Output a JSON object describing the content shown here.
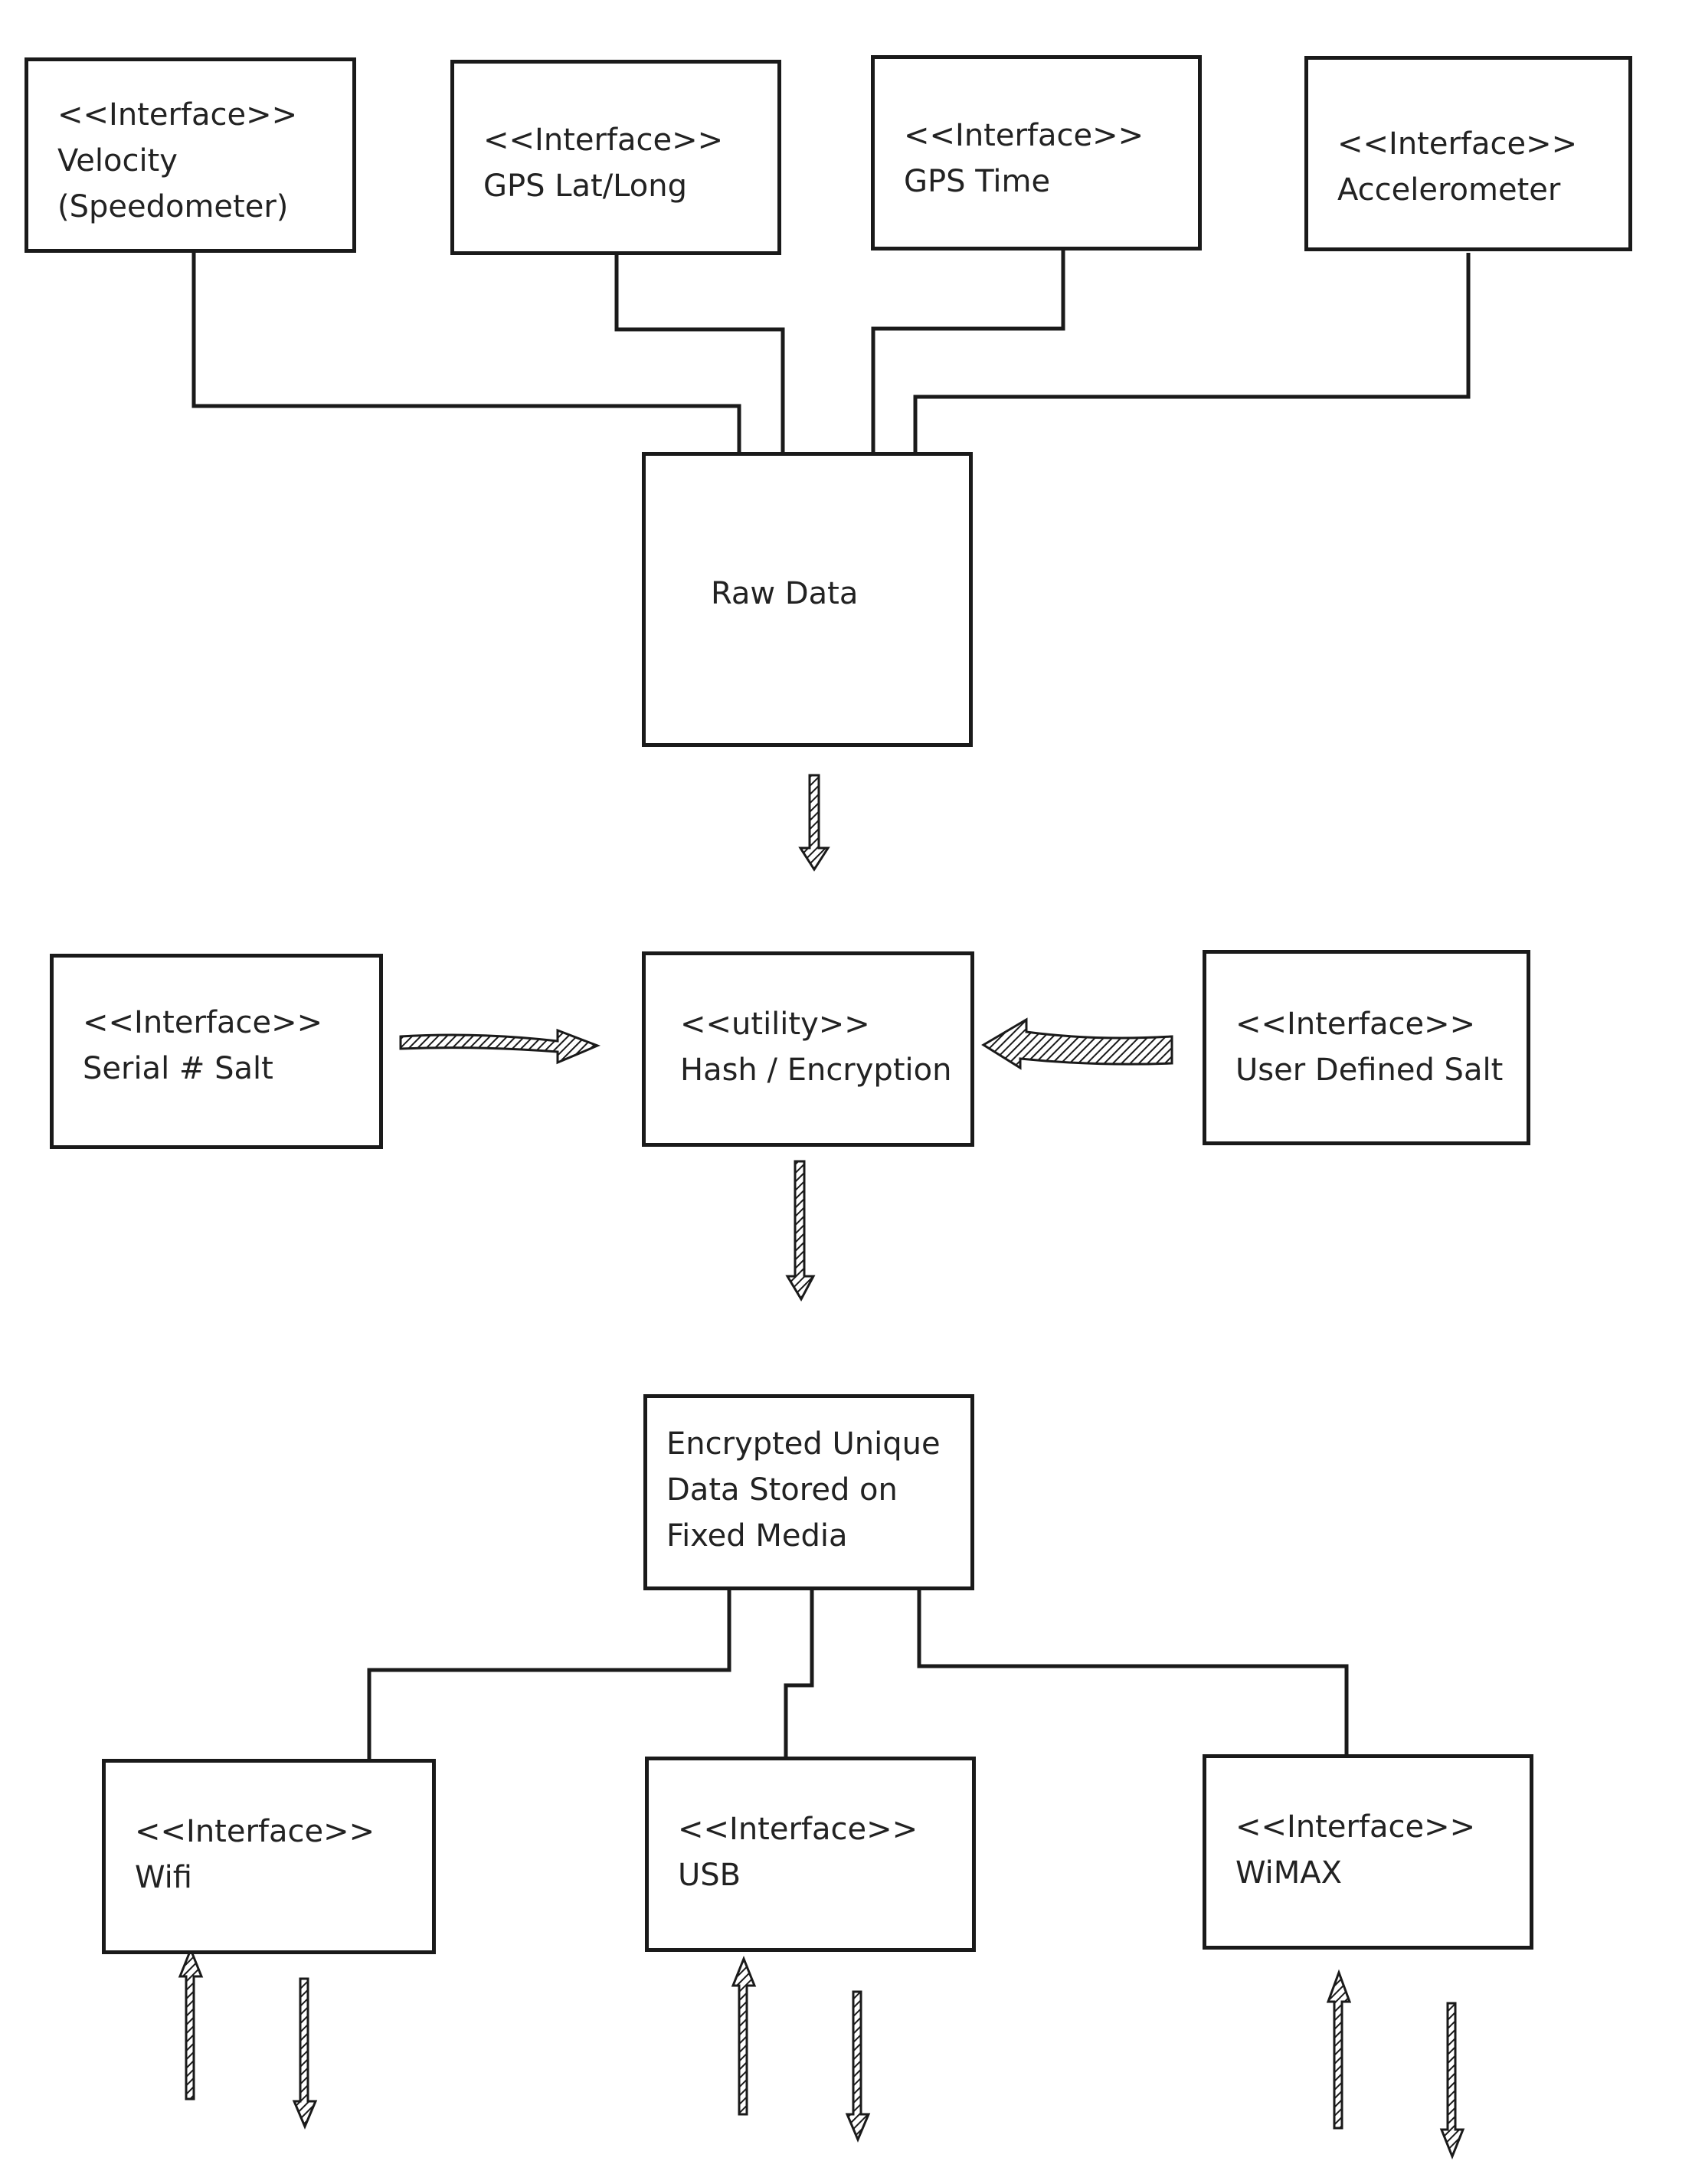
{
  "diagram": {
    "type": "block-diagram",
    "style": {
      "stroke_color": "#1a1a1a",
      "text_color": "#222222",
      "background": "#ffffff"
    },
    "nodes": {
      "velocity": {
        "stereotype": "<<Interface>>",
        "lines": [
          "Velocity",
          "(Speedometer)"
        ]
      },
      "gps_latlong": {
        "stereotype": "<<Interface>>",
        "lines": [
          "GPS Lat/Long"
        ]
      },
      "gps_time": {
        "stereotype": "<<Interface>>",
        "lines": [
          "GPS Time"
        ]
      },
      "accelerometer": {
        "stereotype": "<<Interface>>",
        "lines": [
          "Accelerometer"
        ]
      },
      "raw_data": {
        "lines": [
          "Raw Data"
        ]
      },
      "serial_salt": {
        "stereotype": "<<Interface>>",
        "lines": [
          "Serial # Salt"
        ]
      },
      "hash": {
        "stereotype": "<<utility>>",
        "lines": [
          "Hash / Encryption"
        ]
      },
      "user_salt": {
        "stereotype": "<<Interface>>",
        "lines": [
          "User Defined Salt"
        ]
      },
      "encrypted_store": {
        "lines": [
          "Encrypted Unique",
          "Data Stored on",
          "Fixed Media"
        ]
      },
      "wifi": {
        "stereotype": "<<Interface>>",
        "lines": [
          "Wifi"
        ]
      },
      "usb": {
        "stereotype": "<<Interface>>",
        "lines": [
          "USB"
        ]
      },
      "wimax": {
        "stereotype": "<<Interface>>",
        "lines": [
          "WiMAX"
        ]
      }
    },
    "edges": [
      {
        "from": "velocity",
        "to": "raw_data",
        "kind": "line"
      },
      {
        "from": "gps_latlong",
        "to": "raw_data",
        "kind": "line"
      },
      {
        "from": "gps_time",
        "to": "raw_data",
        "kind": "line"
      },
      {
        "from": "accelerometer",
        "to": "raw_data",
        "kind": "line"
      },
      {
        "from": "raw_data",
        "to": "hash",
        "kind": "arrow"
      },
      {
        "from": "serial_salt",
        "to": "hash",
        "kind": "arrow"
      },
      {
        "from": "user_salt",
        "to": "hash",
        "kind": "arrow"
      },
      {
        "from": "hash",
        "to": "encrypted_store",
        "kind": "arrow"
      },
      {
        "from": "encrypted_store",
        "to": "wifi",
        "kind": "line"
      },
      {
        "from": "encrypted_store",
        "to": "usb",
        "kind": "line"
      },
      {
        "from": "encrypted_store",
        "to": "wimax",
        "kind": "line"
      },
      {
        "node": "wifi",
        "kind": "bidirectional-io-arrows"
      },
      {
        "node": "usb",
        "kind": "bidirectional-io-arrows"
      },
      {
        "node": "wimax",
        "kind": "bidirectional-io-arrows"
      }
    ]
  }
}
